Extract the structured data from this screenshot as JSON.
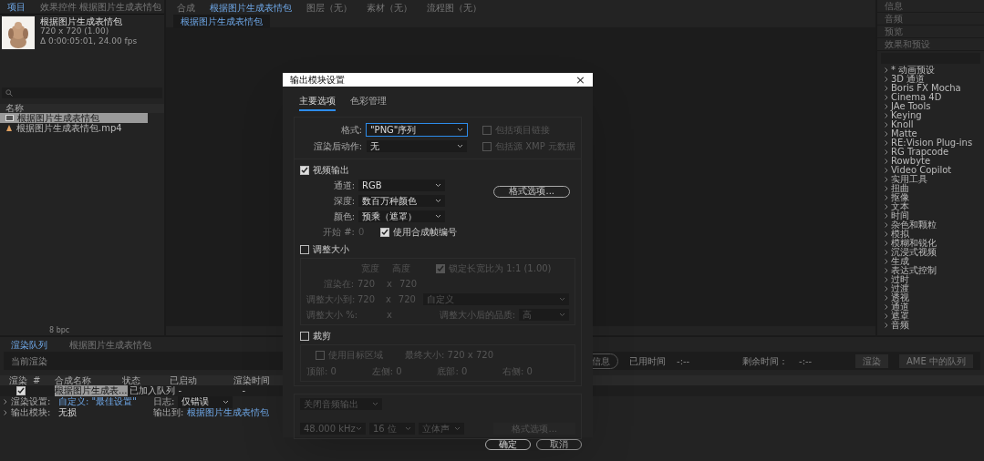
{
  "project_panel": {
    "tabs": [
      {
        "label": "项目",
        "selected": true
      },
      {
        "label": "效果控件 根据图片生成表情包",
        "selected": false
      }
    ],
    "item": {
      "name": "根据图片生成表情包",
      "size": "720 x 720 (1.00)",
      "duration": "Δ 0:00:05:01, 24.00 fps"
    },
    "column": "名称",
    "rows": [
      {
        "kind": "comp",
        "name": "根据图片生成表情包",
        "selected": true
      },
      {
        "kind": "footage",
        "name": "根据图片生成表情包.mp4",
        "selected": false
      }
    ],
    "bpc": "8 bpc"
  },
  "comp_panel": {
    "tabs": [
      {
        "label": "合成",
        "selected": false
      },
      {
        "label": "根据图片生成表情包",
        "selected": true
      },
      {
        "label": "图层（无）",
        "selected": false
      },
      {
        "label": "素材（无）",
        "selected": false
      },
      {
        "label": "流程图（无）",
        "selected": false
      }
    ],
    "subtab": "根据图片生成表情包"
  },
  "right_panel": {
    "sections": [
      "信息",
      "音频",
      "预览",
      "效果和预设"
    ],
    "effects": [
      "* 动画预设",
      "3D 通道",
      "Boris FX Mocha",
      "Cinema 4D",
      "JAe Tools",
      "Keying",
      "Knoll",
      "Matte",
      "RE:Vision Plug-ins",
      "RG Trapcode",
      "Rowbyte",
      "Video Copilot",
      "实用工具",
      "扭曲",
      "抠像",
      "文本",
      "时间",
      "杂色和颗粒",
      "模拟",
      "模糊和锐化",
      "沉浸式视频",
      "生成",
      "表达式控制",
      "过时",
      "过渡",
      "透视",
      "通道",
      "遮罩",
      "音频"
    ]
  },
  "render_queue": {
    "tabs": [
      {
        "label": "渲染队列",
        "selected": true
      },
      {
        "label": "根据图片生成表情包",
        "selected": false
      }
    ],
    "current_render": "当前渲染",
    "info": "信息",
    "elapsed_label": "已用时间",
    "elapsed": "-:--",
    "remaining_label": "剩余时间：",
    "remaining": "-:--",
    "render_button": "渲染",
    "ame_button": "AME 中的队列",
    "columns": [
      "渲染",
      "#",
      "合成名称",
      "状态",
      "已启动",
      "渲染时间"
    ],
    "row": {
      "checked": true,
      "comp": "根据图片生成表...",
      "status": "已加入队列",
      "started": "-",
      "render_time": "-"
    },
    "render_settings_label": "渲染设置:",
    "render_settings": "自定义: \"最佳设置\"",
    "log_label": "日志:",
    "log": "仅错误",
    "output_module_label": "输出模块:",
    "output_module": "无损",
    "output_to_label": "输出到:",
    "output_to": "根据图片生成表情包"
  },
  "dialog": {
    "title": "输出模块设置",
    "close": "×",
    "tabs": [
      {
        "label": "主要选项",
        "selected": true
      },
      {
        "label": "色彩管理",
        "selected": false
      }
    ],
    "format_label": "格式:",
    "format": "\"PNG\"序列",
    "post_render_label": "渲染后动作:",
    "post_render": "无",
    "include_checks": [
      {
        "label": "包括项目链接",
        "checked": false
      },
      {
        "label": "包括源 XMP 元数据",
        "checked": false
      }
    ],
    "video_output": {
      "label": "视频输出",
      "checked": true
    },
    "video_fields": [
      {
        "label": "通道:",
        "value": "RGB"
      },
      {
        "label": "深度:",
        "value": "数百万种颜色"
      },
      {
        "label": "颜色:",
        "value": "预乘（遮罩）"
      }
    ],
    "format_options": "格式选项...",
    "start_label": "开始 #:",
    "start": "0",
    "use_comp_frame": {
      "label": "使用合成帧编号",
      "checked": true
    },
    "resize": {
      "label": "调整大小",
      "checked": false,
      "width": "宽度",
      "height": "高度",
      "lock": {
        "label": "锁定长宽比为 1:1 (1.00)",
        "checked": true
      },
      "render_at": "渲染在:",
      "render_w": "720",
      "render_h": "720",
      "resize_to": "调整大小到:",
      "to_w": "720",
      "to_h": "720",
      "preset": "自定义",
      "percent": "调整大小 %:",
      "x_render": "x",
      "x_to": "x",
      "x_percent": "x",
      "quality_label": "调整大小后的品质:",
      "quality": "高"
    },
    "crop": {
      "label": "裁剪",
      "checked": false,
      "roi": {
        "label": "使用目标区域",
        "checked": false
      },
      "final_size": "最终大小: 720 x 720",
      "sides": [
        "顶部: 0",
        "左侧: 0",
        "底部: 0",
        "右侧: 0"
      ]
    },
    "audio": {
      "mode": "关闭音频输出",
      "rate": "48.000 kHz",
      "bits": "16 位",
      "channels": "立体声",
      "options": "格式选项..."
    },
    "ok": "确定",
    "cancel": "取消"
  }
}
